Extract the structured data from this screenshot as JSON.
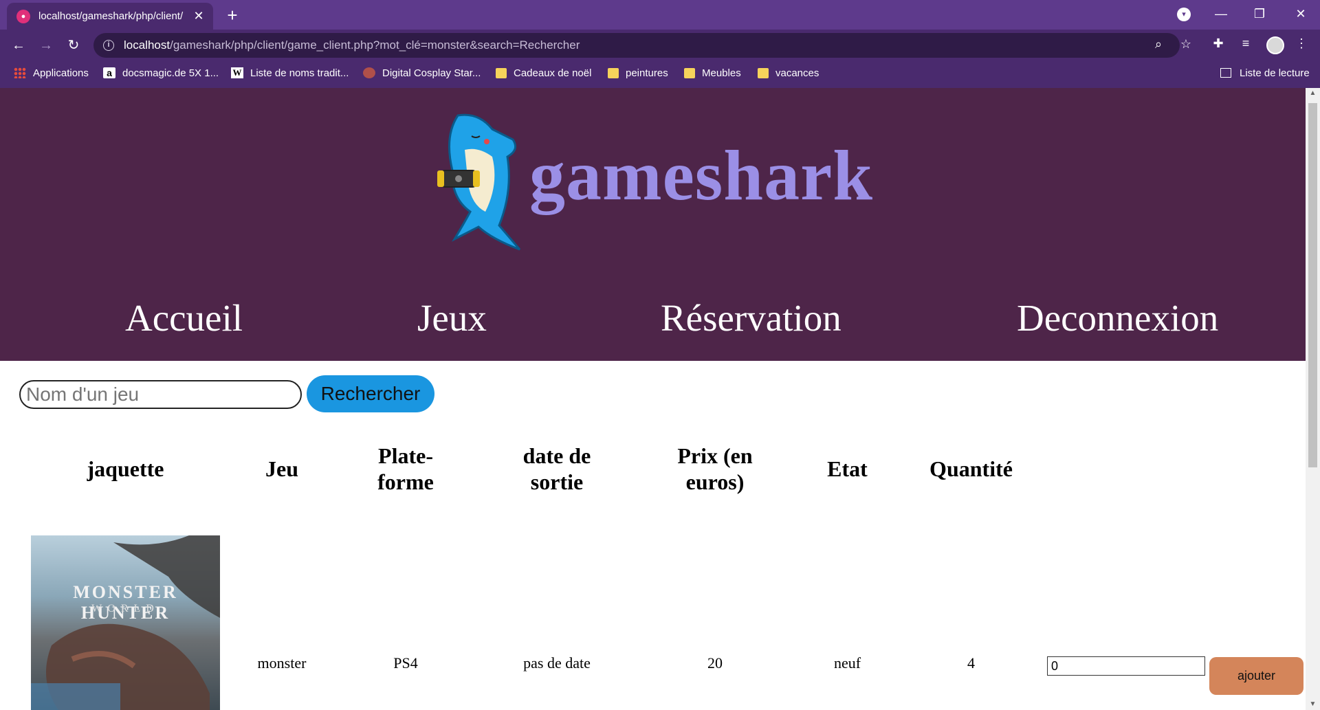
{
  "browser": {
    "tab_title": "localhost/gameshark/php/client/",
    "url_host": "localhost",
    "url_rest": "/gameshark/php/client/game_client.php?mot_clé=monster&search=Rechercher",
    "bookmarks": [
      {
        "label": "Applications",
        "icon": "apps-grid-icon"
      },
      {
        "label": "docsmagic.de 5X 1...",
        "icon": "amazon-icon"
      },
      {
        "label": "Liste de noms tradit...",
        "icon": "wikipedia-icon"
      },
      {
        "label": "Digital Cosplay Star...",
        "icon": "cosplay-favicon-icon"
      },
      {
        "label": "Cadeaux de noël",
        "icon": "folder-icon"
      },
      {
        "label": "peintures",
        "icon": "folder-icon"
      },
      {
        "label": "Meubles",
        "icon": "folder-icon"
      },
      {
        "label": "vacances",
        "icon": "folder-icon"
      }
    ],
    "reading_list": "Liste de lecture"
  },
  "site": {
    "logo_text": "gameshark",
    "nav": [
      "Accueil",
      "Jeux",
      "Réservation",
      "Deconnexion"
    ]
  },
  "search": {
    "placeholder": "Nom d'un jeu",
    "button": "Rechercher"
  },
  "table": {
    "headers": [
      "jaquette",
      "Jeu",
      "Plate-\nforme",
      "date de\nsortie",
      "Prix (en\neuros)",
      "Etat",
      "Quantité"
    ],
    "rows": [
      {
        "cover_title": "MONSTER HUNTER",
        "cover_subtitle": "WORLD",
        "jeu": "monster",
        "plateforme": "PS4",
        "date": "pas de date",
        "prix": "20",
        "etat": "neuf",
        "quantite": "4",
        "qty_value": "0",
        "add_label": "ajouter"
      }
    ]
  },
  "colors": {
    "header_bg": "#4e2549",
    "logo_text": "#9b8fe6",
    "search_button": "#1a96e0",
    "add_button": "#d4855a",
    "browser_frame": "#5e3a8c"
  }
}
